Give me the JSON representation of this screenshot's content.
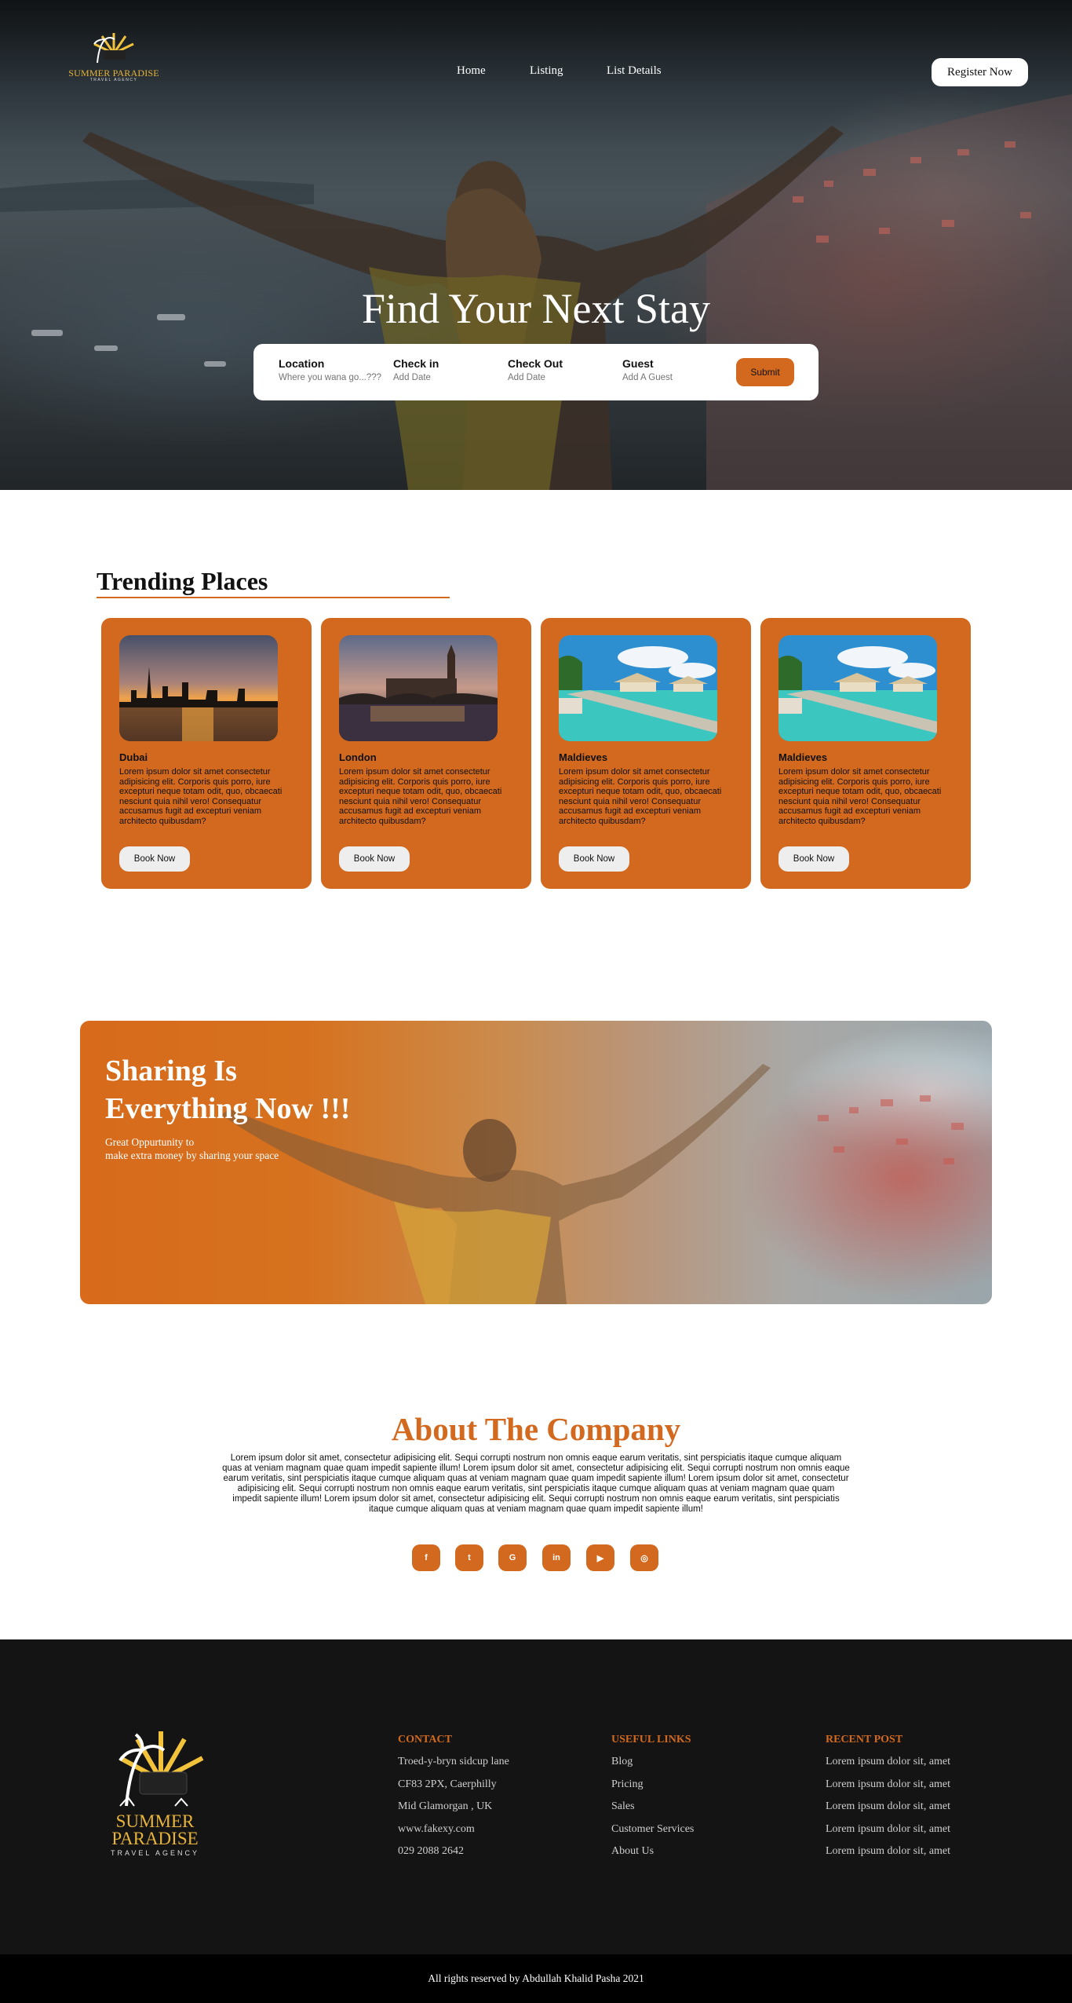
{
  "brand": {
    "name": "SUMMER PARADISE",
    "tagline": "TRAVEL AGENCY"
  },
  "nav": {
    "items": [
      "Home",
      "Listing",
      "List Details"
    ],
    "register_label": "Register Now"
  },
  "hero": {
    "title": "Find Your Next Stay",
    "search": {
      "location_label": "Location",
      "location_placeholder": "Where you wana go...???",
      "checkin_label": "Check in",
      "checkin_placeholder": "Add Date",
      "checkout_label": "Check Out",
      "checkout_placeholder": "Add Date",
      "guest_label": "Guest",
      "guest_placeholder": "Add A Guest",
      "submit_label": "Submit"
    }
  },
  "trending": {
    "title": "Trending Places",
    "cards": [
      {
        "name": "Dubai",
        "description": "Lorem ipsum dolor sit amet consectetur adipisicing elit. Corporis quis porro, iure excepturi neque totam odit, quo, obcaecati nesciunt quia nihil vero! Consequatur accusamus fugit ad excepturi veniam architecto quibusdam?",
        "button": "Book Now",
        "image": "dubai-skyline-sunset"
      },
      {
        "name": "London",
        "description": "Lorem ipsum dolor sit amet consectetur adipisicing elit. Corporis quis porro, iure excepturi neque totam odit, quo, obcaecati nesciunt quia nihil vero! Consequatur accusamus fugit ad excepturi veniam architecto quibusdam?",
        "button": "Book Now",
        "image": "london-big-ben-dusk"
      },
      {
        "name": "Maldieves",
        "description": "Lorem ipsum dolor sit amet consectetur adipisicing elit. Corporis quis porro, iure excepturi neque totam odit, quo, obcaecati nesciunt quia nihil vero! Consequatur accusamus fugit ad excepturi veniam architecto quibusdam?",
        "button": "Book Now",
        "image": "maldives-water-villas"
      },
      {
        "name": "Maldieves",
        "description": "Lorem ipsum dolor sit amet consectetur adipisicing elit. Corporis quis porro, iure excepturi neque totam odit, quo, obcaecati nesciunt quia nihil vero! Consequatur accusamus fugit ad excepturi veniam architecto quibusdam?",
        "button": "Book Now",
        "image": "maldives-water-villas"
      }
    ]
  },
  "sharing": {
    "title_line1": "Sharing Is",
    "title_line2": "Everything Now !!!",
    "sub_line1": "Great Oppurtunity to",
    "sub_line2": "make extra money by sharing your space"
  },
  "about": {
    "title": "About The Company",
    "text_line1": "Lorem ipsum dolor sit amet, consectetur adipisicing elit. Sequi corrupti nostrum non omnis eaque earum veritatis, sint perspiciatis itaque cumque aliquam quas at veniam magnam quae quam impedit sapiente illum! Lorem ipsum dolor sit amet, consectetur adipisicing elit. Sequi corrupti nostrum non omnis eaque earum veritatis, sint perspiciatis itaque cumque aliquam quas at veniam magnam quae quam impedit sapiente illum! Lorem ipsum dolor sit amet, consectetur",
    "text_line2": "adipisicing elit. Sequi corrupti nostrum non omnis eaque earum veritatis, sint perspiciatis itaque cumque aliquam quas at veniam magnam quae quam impedit sapiente illum! Lorem ipsum dolor sit amet, consectetur adipisicing elit. Sequi corrupti nostrum non omnis eaque earum veritatis, sint perspiciatis itaque cumque aliquam quas at veniam magnam quae quam impedit sapiente illum!",
    "socials": [
      {
        "name": "facebook-icon",
        "glyph": "f"
      },
      {
        "name": "twitter-icon",
        "glyph": "t"
      },
      {
        "name": "google-icon",
        "glyph": "G"
      },
      {
        "name": "linkedin-icon",
        "glyph": "in"
      },
      {
        "name": "youtube-icon",
        "glyph": "▶"
      },
      {
        "name": "instagram-icon",
        "glyph": "◎"
      }
    ]
  },
  "footer": {
    "contact": {
      "title": "CONTACT",
      "items": [
        "Troed-y-bryn sidcup lane",
        "CF83 2PX, Caerphilly",
        "Mid Glamorgan , UK",
        "www.fakexy.com",
        "029 2088 2642"
      ]
    },
    "links": {
      "title": "USEFUL LINKS",
      "items": [
        "Blog",
        "Pricing",
        "Sales",
        "Customer Services",
        "About Us"
      ]
    },
    "recent": {
      "title": "RECENT POST",
      "items": [
        "Lorem ipsum dolor sit, amet",
        "Lorem ipsum dolor sit, amet",
        "Lorem ipsum dolor sit, amet",
        "Lorem ipsum dolor sit, amet",
        "Lorem ipsum dolor sit, amet"
      ]
    },
    "copyright": "All rights reserved by Abdullah Khalid Pasha 2021"
  },
  "colors": {
    "accent": "#d2691e",
    "logo_gold": "#e7b339",
    "footer_bg": "#141414"
  }
}
